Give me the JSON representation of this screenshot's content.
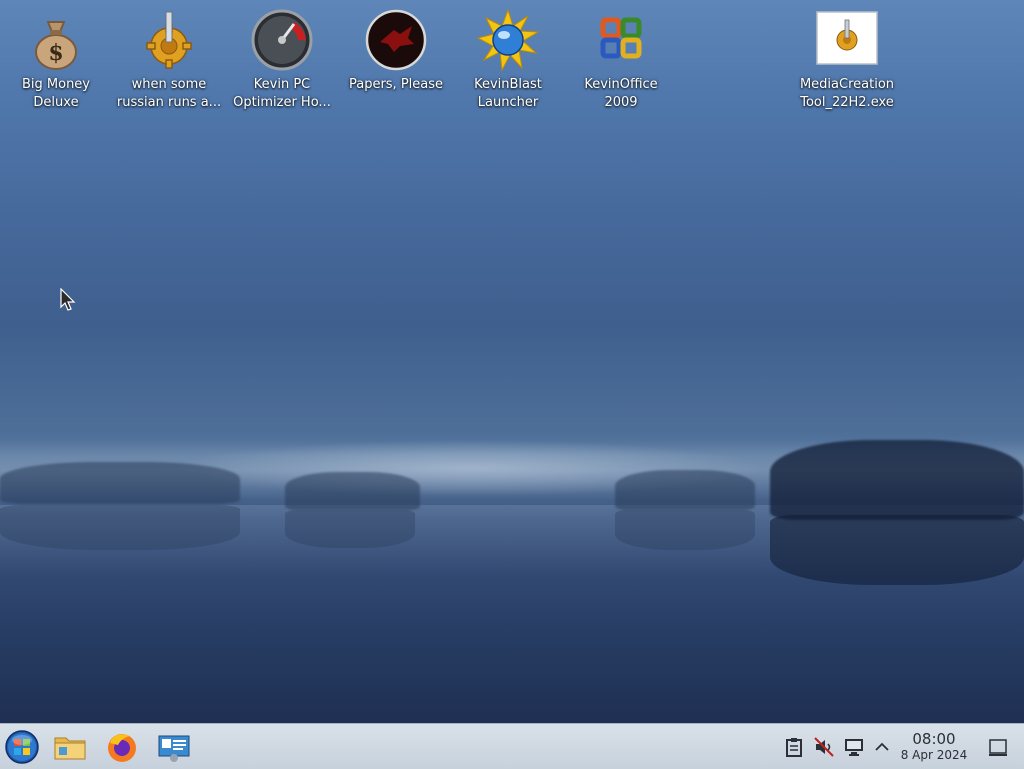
{
  "desktop": {
    "icons": [
      {
        "label": "Big Money\nDeluxe",
        "icon": "money-bag-icon"
      },
      {
        "label": "when some\nrussian runs a...",
        "icon": "gear-installer-icon"
      },
      {
        "label": "Kevin PC\nOptimizer Ho...",
        "icon": "speedometer-icon"
      },
      {
        "label": "Papers, Please",
        "icon": "papers-please-emblem-icon"
      },
      {
        "label": "KevinBlast\nLauncher",
        "icon": "starburst-globe-icon"
      },
      {
        "label": "KevinOffice\n2009",
        "icon": "office-logo-icon"
      },
      {
        "label": "MediaCreation\nTool_22H2.exe",
        "icon": "exe-file-icon"
      }
    ]
  },
  "taskbar": {
    "start_icon": "start-orb-icon",
    "pinned": [
      {
        "icon": "file-manager-icon"
      },
      {
        "icon": "firefox-icon"
      },
      {
        "icon": "system-settings-icon"
      }
    ],
    "tray": [
      {
        "icon": "clipboard-icon"
      },
      {
        "icon": "speaker-muted-icon"
      },
      {
        "icon": "display-monitor-icon"
      },
      {
        "icon": "chevron-up-icon"
      }
    ],
    "clock": {
      "time": "08:00",
      "date": "8 Apr 2024"
    },
    "show_desktop_icon": "show-desktop-icon"
  }
}
